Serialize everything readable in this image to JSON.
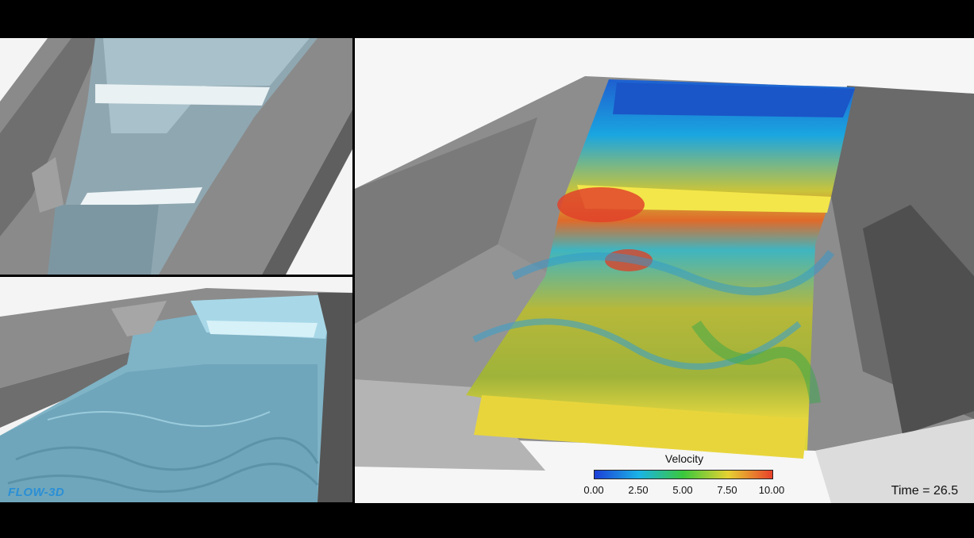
{
  "left_top": {
    "label": ""
  },
  "left_bottom": {
    "logo": "FLOW-3D"
  },
  "main": {
    "legend": {
      "title": "Velocity",
      "ticks": [
        "0.00",
        "2.50",
        "5.00",
        "7.50",
        "10.00"
      ],
      "colors": [
        "#1d3fd8",
        "#1ab3e6",
        "#3bc83b",
        "#e6d233",
        "#e8402a"
      ]
    },
    "time_label": "Time = 26.5"
  }
}
